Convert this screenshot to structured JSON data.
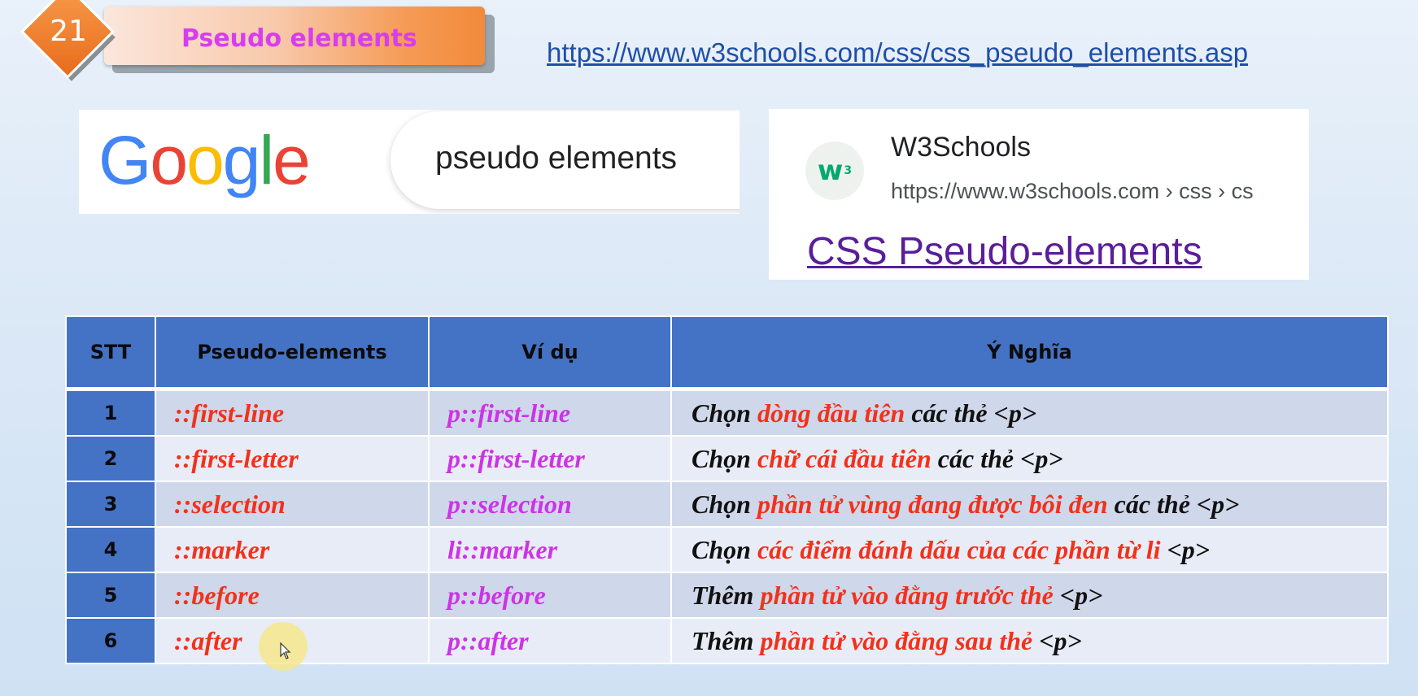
{
  "header": {
    "number": "21",
    "title": "Pseudo elements",
    "url": "https://www.w3schools.com/css/css_pseudo_elements.asp"
  },
  "google": {
    "logo_letters": [
      "G",
      "o",
      "o",
      "g",
      "l",
      "e"
    ],
    "logo_colors": [
      "#4285f4",
      "#ea4335",
      "#fbbc05",
      "#4285f4",
      "#34a853",
      "#ea4335"
    ],
    "search_query": "pseudo elements"
  },
  "result": {
    "site_name": "W3Schools",
    "breadcrumb": "https://www.w3schools.com › css › cs",
    "title": "CSS Pseudo-elements",
    "icon_text": "w",
    "icon_sup": "3"
  },
  "table": {
    "headers": [
      "STT",
      "Pseudo-elements",
      "Ví dụ",
      "Ý Nghĩa"
    ],
    "rows": [
      {
        "stt": "1",
        "pseudo": "::first-line",
        "example": "p::first-line",
        "meaning": {
          "pre": "Chọn ",
          "highlight": "dòng đầu tiên",
          "post": " các thẻ <p>"
        }
      },
      {
        "stt": "2",
        "pseudo": "::first-letter",
        "example": "p::first-letter",
        "meaning": {
          "pre": "Chọn ",
          "highlight": "chữ cái đầu tiên",
          "post": " các thẻ <p>"
        }
      },
      {
        "stt": "3",
        "pseudo": "::selection",
        "example": "p::selection",
        "meaning": {
          "pre": "Chọn ",
          "highlight": "phần tử vùng đang được bôi đen",
          "post": " các thẻ <p>"
        }
      },
      {
        "stt": "4",
        "pseudo": "::marker",
        "example": "li::marker",
        "meaning": {
          "pre": "Chọn ",
          "highlight": "các điểm đánh dấu của các phần từ li",
          "post": " <p>"
        }
      },
      {
        "stt": "5",
        "pseudo": "::before",
        "example": "p::before",
        "meaning": {
          "pre": "Thêm ",
          "highlight": "phần tử vào đằng trước thẻ",
          "post": " <p>"
        }
      },
      {
        "stt": "6",
        "pseudo": "::after",
        "example": "p::after",
        "meaning": {
          "pre": "Thêm ",
          "highlight": "phần tử vào đằng sau thẻ",
          "post": " <p>"
        }
      }
    ]
  },
  "colors": {
    "header_blue": "#4472c4",
    "pseudo_red": "#f2311b",
    "example_magenta": "#cc33e6",
    "title_magenta": "#d73df0",
    "link_blue": "#1f4fa8",
    "result_purple": "#5a1e9a"
  }
}
